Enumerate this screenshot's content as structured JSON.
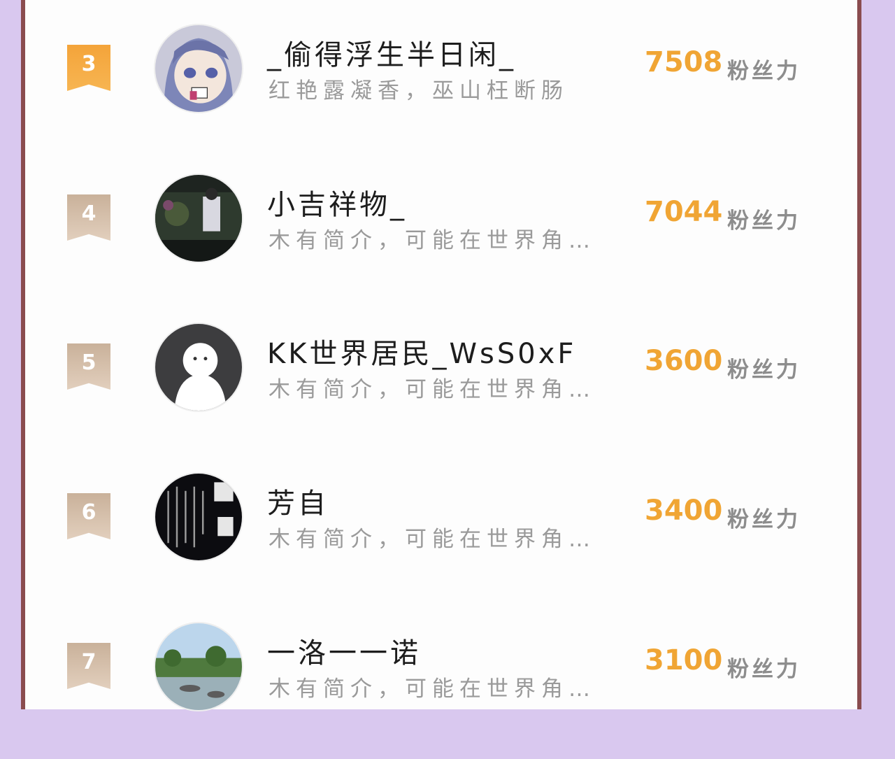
{
  "colors": {
    "background": "#d9c8ef",
    "frame": "#8a4c4f",
    "score": "#f0a534",
    "gold_badge": "#f4a43a",
    "beige_badge": "#c9b19a"
  },
  "ranking": {
    "unit_label": "粉丝力",
    "rows": [
      {
        "rank": "3",
        "name": "_偷得浮生半日闲_",
        "bio": "红艳露凝香，巫山枉断肠",
        "score": "7508",
        "avatar_icon": "anime-girl-avatar"
      },
      {
        "rank": "4",
        "name": "小吉祥物_",
        "bio": "木有简介，可能在世界角…",
        "score": "7044",
        "avatar_icon": "photo-avatar"
      },
      {
        "rank": "5",
        "name": "KK世界居民_WsS0xF",
        "bio": "木有简介，可能在世界角…",
        "score": "3600",
        "avatar_icon": "default-ghost-avatar"
      },
      {
        "rank": "6",
        "name": "芳自",
        "bio": "木有简介，可能在世界角…",
        "score": "3400",
        "avatar_icon": "calligraphy-avatar"
      },
      {
        "rank": "7",
        "name": "一洛一一诺",
        "bio": "木有简介，可能在世界角…",
        "score": "3100",
        "avatar_icon": "landscape-avatar"
      }
    ]
  }
}
